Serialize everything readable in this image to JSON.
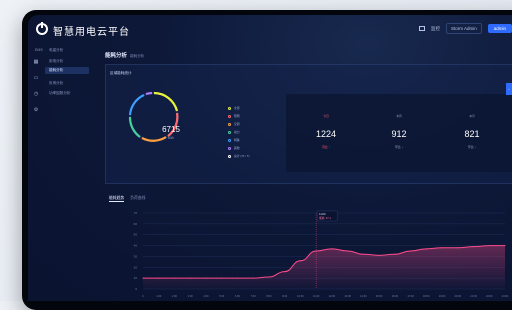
{
  "app": {
    "title": "智慧用电云平台"
  },
  "header": {
    "monitor_label": "监控",
    "area_select": "Storm Admin",
    "user_label": "admin"
  },
  "sidebar_icons": [
    "grid-icon",
    "monitor-icon",
    "clock-icon",
    "settings-icon"
  ],
  "nav": {
    "section": "EMS",
    "group": "电量分析",
    "items": [
      "用电分析",
      "能耗分析",
      "负荷分析",
      "功率因数分析"
    ],
    "active_index": 1
  },
  "page": {
    "title": "能耗分析",
    "subtitle": "能耗分析"
  },
  "summary": {
    "title": "区域能耗统计",
    "ring": {
      "value": "6715",
      "unit": "kWh"
    },
    "legend": [
      {
        "label": "全部",
        "color": "#e9f23a"
      },
      {
        "label": "照明",
        "color": "#ff6b6b"
      },
      {
        "label": "空调",
        "color": "#ff9f40"
      },
      {
        "label": "动力",
        "color": "#44d19b"
      },
      {
        "label": "特殊",
        "color": "#3aa0ff"
      },
      {
        "label": "其他",
        "color": "#b07cff"
      },
      {
        "label": "总计 (T1 / T)",
        "color": "#ffffff"
      }
    ],
    "stats": [
      {
        "label": "今日",
        "value": "1224",
        "change": "同比 ↑",
        "highlight": true
      },
      {
        "label": "本周",
        "value": "912",
        "change": "环比 ↓",
        "highlight": false
      },
      {
        "label": "本月",
        "value": "821",
        "change": "环比 ↓",
        "highlight": false
      }
    ]
  },
  "trend": {
    "tabs": [
      "能耗趋势",
      "负荷曲线"
    ],
    "active_tab": 0,
    "tooltip": [
      "11:00",
      "能耗: 37.1"
    ]
  },
  "chart_data": {
    "type": "area",
    "x": [
      "0",
      "1:00",
      "2:00",
      "3:00",
      "4:00",
      "5:00",
      "6:00",
      "7:00",
      "8:00",
      "9:00",
      "10:00",
      "11:00",
      "12:00",
      "13:00",
      "14:00",
      "15:00",
      "16:00",
      "17:00",
      "18:00",
      "19:00",
      "20:00",
      "21:00",
      "22:00",
      "23:00"
    ],
    "y": [
      10,
      10,
      10,
      10,
      10,
      10,
      10,
      10,
      11,
      16,
      26,
      35,
      37,
      35,
      32,
      31,
      32,
      35,
      37,
      38,
      38,
      39,
      40,
      40
    ],
    "yticks": [
      "0",
      "10",
      "20",
      "30",
      "40",
      "50",
      "60",
      "70"
    ],
    "ylim": [
      0,
      70
    ],
    "series_color": "#ff4b8b"
  }
}
